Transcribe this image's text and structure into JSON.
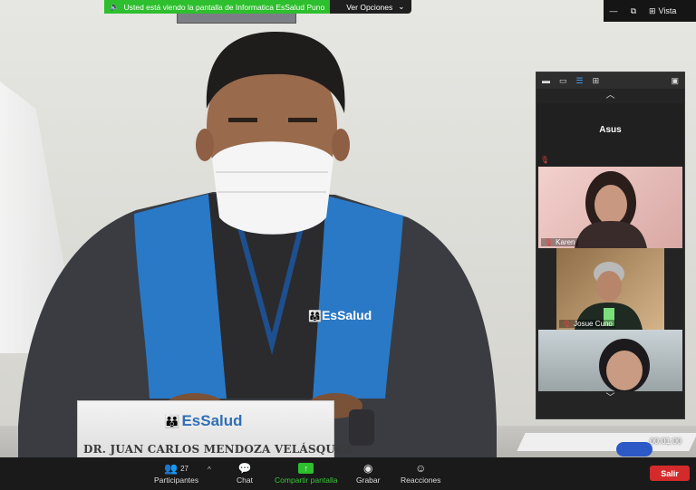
{
  "share_banner": {
    "message": "Usted está viendo la pantalla de Informatica EsSalud Puno",
    "options_label": "Ver Opciones"
  },
  "window_controls": {
    "view_label": "Vista"
  },
  "video": {
    "badge_text": "EsSalud",
    "nameplate_logo": "EsSalud",
    "nameplate_name": "DR. JUAN CARLOS MENDOZA VELÁSQUEZ",
    "timer": "00:01:00"
  },
  "gallery": {
    "self_name": "Asus",
    "participants": [
      {
        "name": "Karen"
      },
      {
        "name": "Josue Cuno"
      },
      {
        "name": ""
      }
    ]
  },
  "toolbar": {
    "participants_label": "Participantes",
    "participants_count": "27",
    "chat_label": "Chat",
    "share_label": "Compartir pantalla",
    "record_label": "Grabar",
    "reactions_label": "Reacciones",
    "leave_label": "Salir"
  },
  "colors": {
    "share_green": "#2dbf2d",
    "leave_red": "#d32b2b",
    "toolbar_bg": "#1a1a1a",
    "essalud_blue": "#2f6fb6"
  },
  "icons": [
    "speaker-icon",
    "chevron-down-icon",
    "minimize-icon",
    "restore-icon",
    "grid-icon",
    "participants-icon",
    "chat-icon",
    "share-screen-icon",
    "record-icon",
    "reactions-icon",
    "mic-muted-icon",
    "chevron-up-icon"
  ]
}
